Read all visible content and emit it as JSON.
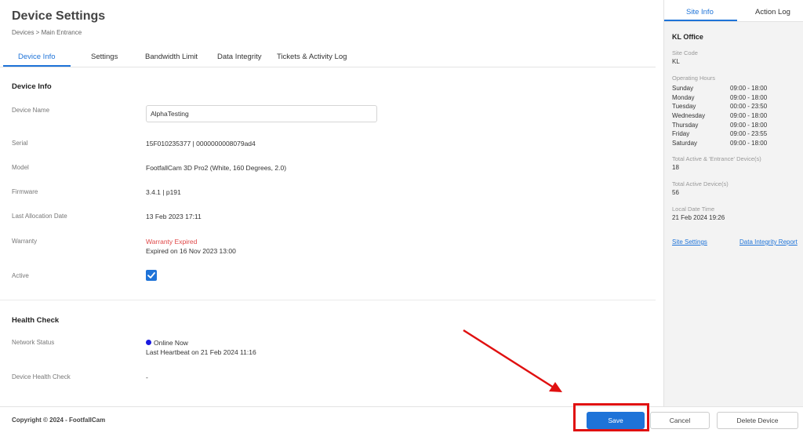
{
  "header": {
    "title": "Device Settings",
    "breadcrumb": "Devices > Main Entrance"
  },
  "tabs": [
    {
      "label": "Device Info",
      "active": true
    },
    {
      "label": "Settings"
    },
    {
      "label": "Bandwidth Limit"
    },
    {
      "label": "Data Integrity"
    },
    {
      "label": "Tickets & Activity Log"
    }
  ],
  "device_info": {
    "section_title": "Device Info",
    "device_name_label": "Device Name",
    "device_name_value": "AlphaTesting",
    "serial_label": "Serial",
    "serial_value": "15F010235377 | 0000000008079ad4",
    "model_label": "Model",
    "model_value": "FootfallCam 3D Pro2 (White, 160 Degrees, 2.0)",
    "firmware_label": "Firmware",
    "firmware_value": "3.4.1 | p191",
    "last_alloc_label": "Last Allocation Date",
    "last_alloc_value": "13 Feb 2023 17:11",
    "warranty_label": "Warranty",
    "warranty_status": "Warranty Expired",
    "warranty_detail": "Expired on 16 Nov 2023 13:00",
    "active_label": "Active",
    "active_checked": true
  },
  "health_check": {
    "section_title": "Health Check",
    "network_label": "Network Status",
    "network_status": "Online Now",
    "last_heartbeat": "Last Heartbeat on 21 Feb 2024 11:16",
    "device_health_label": "Device Health Check",
    "device_health_value": "-"
  },
  "footer": {
    "copyright": "Copyright © 2024 - FootfallCam",
    "save_label": "Save",
    "cancel_label": "Cancel",
    "delete_label": "Delete Device"
  },
  "sidebar": {
    "tabs": [
      {
        "label": "Site Info",
        "active": true
      },
      {
        "label": "Action Log"
      }
    ],
    "site_name": "KL Office",
    "site_code_label": "Site Code",
    "site_code": "KL",
    "operating_hours_label": "Operating Hours",
    "hours": [
      {
        "day": "Sunday",
        "time": "09:00 - 18:00"
      },
      {
        "day": "Monday",
        "time": "09:00 - 18:00"
      },
      {
        "day": "Tuesday",
        "time": "00:00 - 23:50"
      },
      {
        "day": "Wednesday",
        "time": "09:00 - 18:00"
      },
      {
        "day": "Thursday",
        "time": "09:00 - 18:00"
      },
      {
        "day": "Friday",
        "time": "09:00 - 23:55"
      },
      {
        "day": "Saturday",
        "time": "09:00 - 18:00"
      }
    ],
    "total_active_entrance_label": "Total Active & 'Entrance' Device(s)",
    "total_active_entrance": "18",
    "total_active_label": "Total Active Device(s)",
    "total_active": "56",
    "local_time_label": "Local Date Time",
    "local_time": "21 Feb 2024 19:26",
    "site_settings_link": "Site Settings",
    "data_integrity_link": "Data Integrity Report"
  },
  "colors": {
    "accent": "#1e73d8",
    "warning": "#e04848",
    "online_dot": "#1a1ae0",
    "highlight": "#e01010"
  }
}
